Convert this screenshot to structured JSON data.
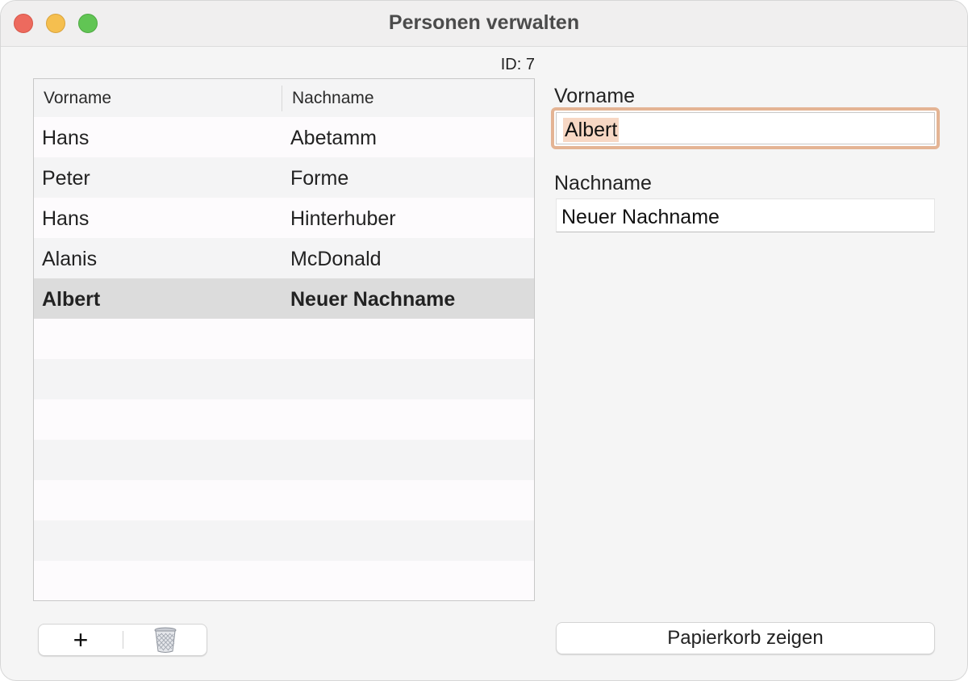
{
  "window": {
    "title": "Personen verwalten"
  },
  "record": {
    "id_label": "ID: 7"
  },
  "table": {
    "columns": [
      "Vorname",
      "Nachname"
    ],
    "rows": [
      {
        "vorname": "Hans",
        "nachname": "Abetamm"
      },
      {
        "vorname": "Peter",
        "nachname": "Forme"
      },
      {
        "vorname": "Hans",
        "nachname": "Hinterhuber"
      },
      {
        "vorname": "Alanis",
        "nachname": "McDonald"
      },
      {
        "vorname": "Albert",
        "nachname": "Neuer Nachname"
      }
    ],
    "selected_row": 4
  },
  "form": {
    "vorname_label": "Vorname",
    "vorname_value": "Albert",
    "nachname_label": "Nachname",
    "nachname_value": "Neuer Nachname"
  },
  "buttons": {
    "add_label": "+",
    "delete_icon": "trash-icon",
    "show_trash_label": "Papierkorb zeigen"
  },
  "colors": {
    "focus_ring": "#e4b494",
    "text_selection": "#f7d7c4",
    "selected_row": "#dcdcdc",
    "close": "#ed6a5e",
    "minimize": "#f5bf4f",
    "zoom": "#61c554"
  }
}
